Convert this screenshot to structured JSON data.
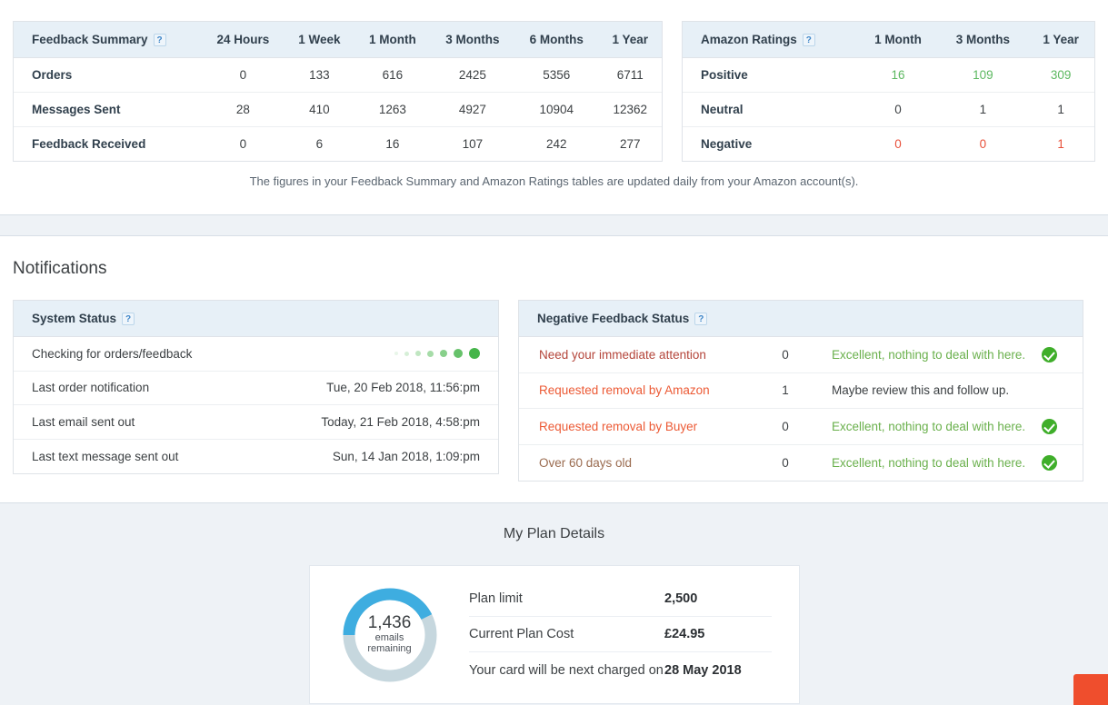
{
  "feedback_summary": {
    "title": "Feedback Summary",
    "help_icon": "question-mark-icon",
    "columns": [
      "24 Hours",
      "1 Week",
      "1 Month",
      "3 Months",
      "6 Months",
      "1 Year"
    ],
    "rows": [
      {
        "label": "Orders",
        "values": [
          "0",
          "133",
          "616",
          "2425",
          "5356",
          "6711"
        ]
      },
      {
        "label": "Messages Sent",
        "values": [
          "28",
          "410",
          "1263",
          "4927",
          "10904",
          "12362"
        ]
      },
      {
        "label": "Feedback Received",
        "values": [
          "0",
          "6",
          "16",
          "107",
          "242",
          "277"
        ]
      }
    ]
  },
  "amazon_ratings": {
    "title": "Amazon Ratings",
    "help_icon": "question-mark-icon",
    "columns": [
      "1 Month",
      "3 Months",
      "1 Year"
    ],
    "rows": [
      {
        "label": "Positive",
        "values": [
          "16",
          "109",
          "309"
        ],
        "tone": "pos"
      },
      {
        "label": "Neutral",
        "values": [
          "0",
          "1",
          "1"
        ],
        "tone": ""
      },
      {
        "label": "Negative",
        "values": [
          "0",
          "0",
          "1"
        ],
        "tone": "neg"
      }
    ]
  },
  "tables_note": "The figures in your Feedback Summary and Amazon Ratings tables are updated daily from your Amazon account(s).",
  "notifications": {
    "heading": "Notifications",
    "system_status": {
      "title": "System Status",
      "help_icon": "question-mark-icon",
      "rows": [
        {
          "label": "Checking for orders/feedback",
          "value": "",
          "indicator": "loading-dots"
        },
        {
          "label": "Last order notification",
          "value": "Tue, 20 Feb 2018, 11:56:pm"
        },
        {
          "label": "Last email sent out",
          "value": "Today, 21 Feb 2018, 4:58:pm"
        },
        {
          "label": "Last text message sent out",
          "value": "Sun, 14 Jan 2018, 1:09:pm"
        }
      ]
    },
    "negative_feedback": {
      "title": "Negative Feedback Status",
      "help_icon": "question-mark-icon",
      "rows": [
        {
          "label": "Need your immediate attention",
          "count": "0",
          "message": "Excellent, nothing to deal with here.",
          "status": "ok",
          "label_color": "#b4453a"
        },
        {
          "label": "Requested removal by Amazon",
          "count": "1",
          "message": "Maybe review this and follow up.",
          "status": "warn",
          "label_color": "#ec5a35"
        },
        {
          "label": "Requested removal by Buyer",
          "count": "0",
          "message": "Excellent, nothing to deal with here.",
          "status": "ok",
          "label_color": "#ec5a35"
        },
        {
          "label": "Over 60 days old",
          "count": "0",
          "message": "Excellent, nothing to deal with here.",
          "status": "ok",
          "label_color": "#9a6b4f"
        }
      ]
    }
  },
  "plan": {
    "title": "My Plan Details",
    "donut": {
      "number": "1,436",
      "sub_line1": "emails",
      "sub_line2": "remaining",
      "used_percent": 42.6,
      "used_color": "#3eade0",
      "remaining_color": "#c6d7de"
    },
    "rows": [
      {
        "label": "Plan limit",
        "value": "2,500"
      },
      {
        "label": "Current Plan Cost",
        "value": "£24.95"
      },
      {
        "label": "Your card will be next charged on",
        "value": "28 May 2018"
      }
    ]
  },
  "chat_widget": {
    "name": "chat-launcher",
    "color": "#ef4e2d"
  },
  "colors": {
    "header_bg": "#e7f0f7",
    "border": "#dfe3e8",
    "positive": "#5cb860",
    "negative": "#e8503a",
    "band_bg": "#eef2f6"
  }
}
